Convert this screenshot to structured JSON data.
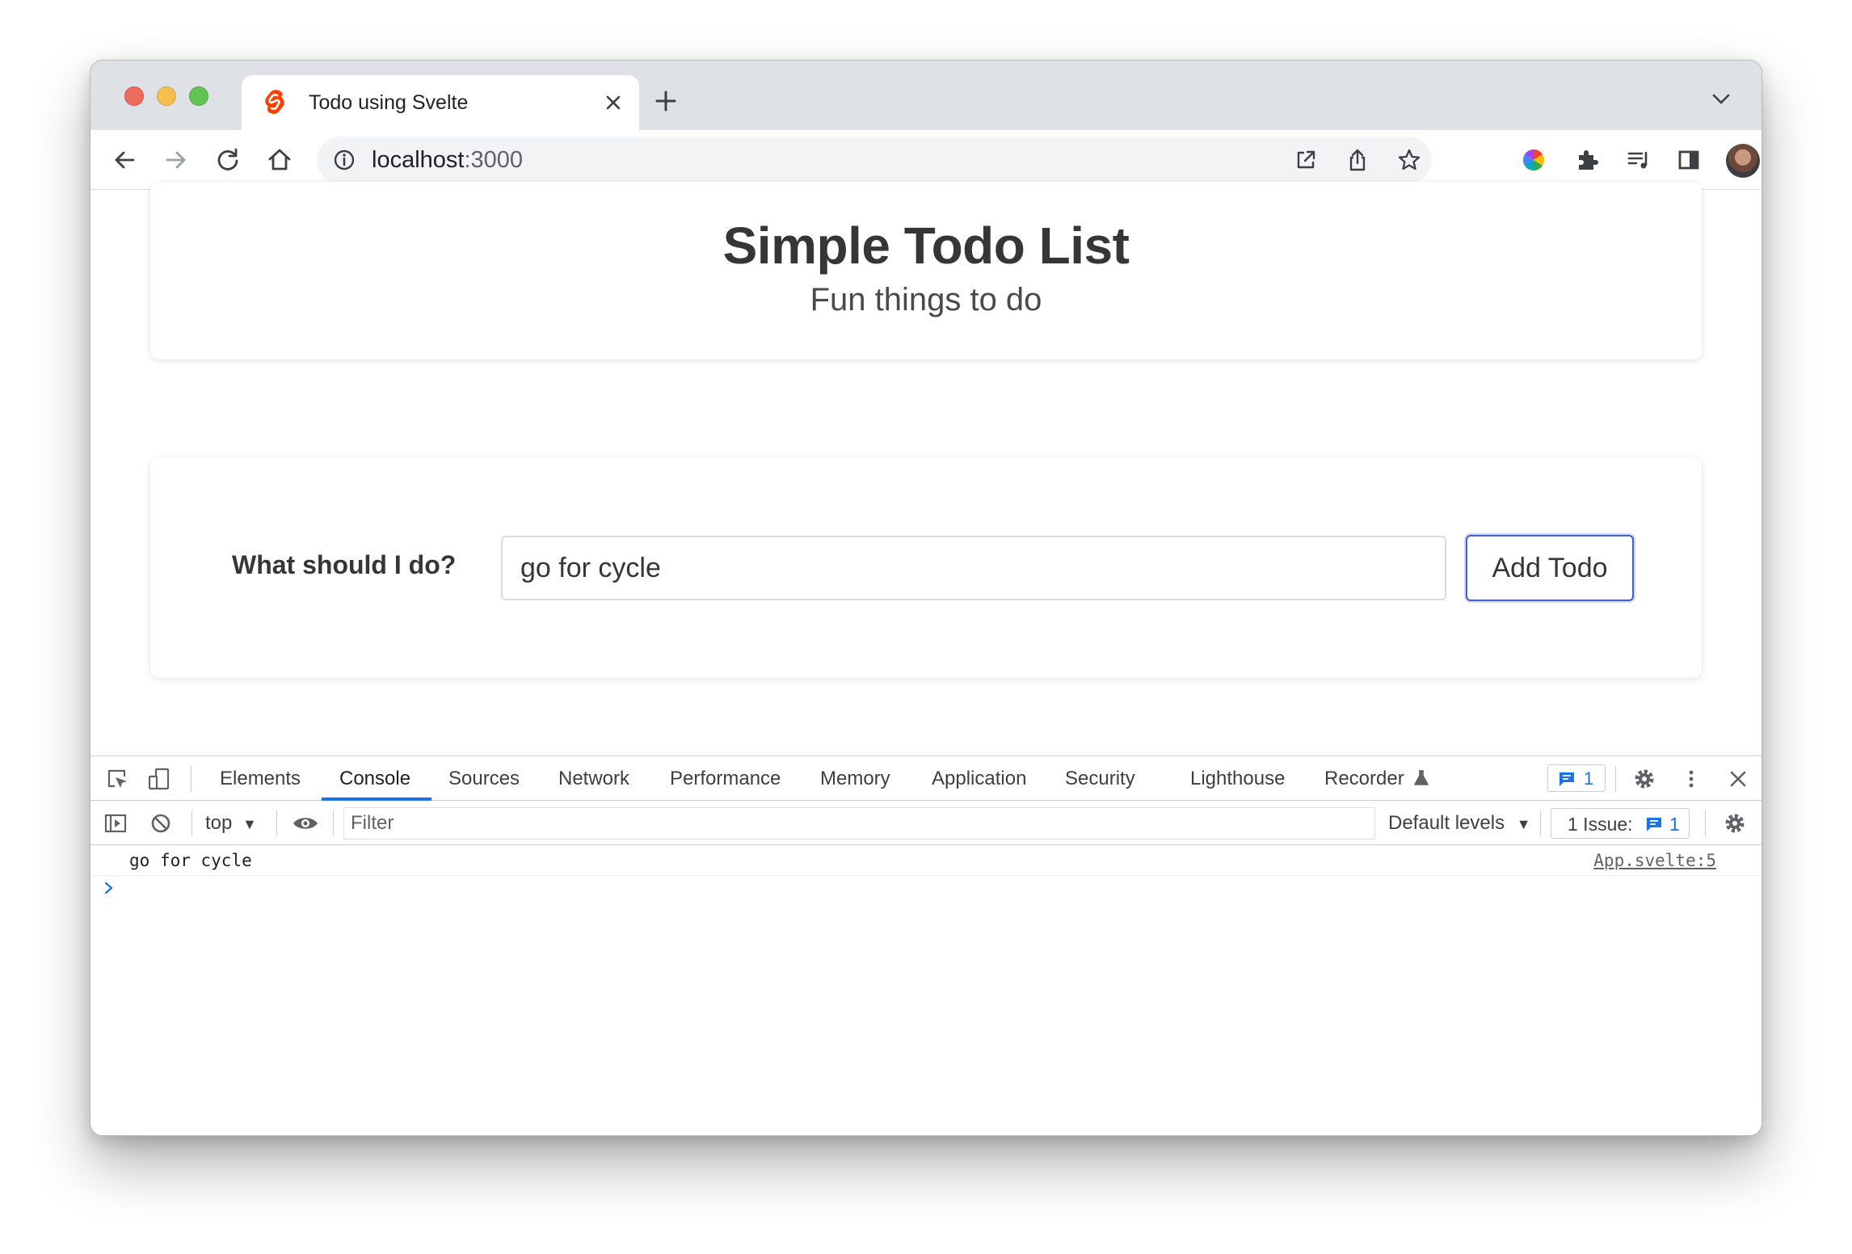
{
  "browser": {
    "tab": {
      "title": "Todo using Svelte",
      "favicon": "svelte-logo-icon"
    },
    "address": {
      "host": "localhost",
      "port": ":3000"
    },
    "colors": {
      "tabstrip": "#dee1e6",
      "omnibox": "#f1f3f4",
      "svelte": "#ff3e00"
    }
  },
  "page": {
    "hero": {
      "title": "Simple Todo List",
      "subtitle": "Fun things to do"
    },
    "form": {
      "label": "What should I do?",
      "input_value": "go for cycle",
      "button_label": "Add Todo",
      "button_border": "#485fc7"
    }
  },
  "devtools": {
    "tabs": [
      {
        "label": "Elements"
      },
      {
        "label": "Console",
        "active": true
      },
      {
        "label": "Sources"
      },
      {
        "label": "Network"
      },
      {
        "label": "Performance"
      },
      {
        "label": "Memory"
      },
      {
        "label": "Application"
      },
      {
        "label": "Security"
      },
      {
        "label": "Lighthouse"
      },
      {
        "label": "Recorder"
      }
    ],
    "message_badge_count": "1",
    "filterbar": {
      "context": "top",
      "filter_placeholder": "Filter",
      "levels": "Default levels",
      "issues_label": "1 Issue:",
      "issues_count": "1"
    },
    "console": {
      "messages": [
        {
          "text": "go for cycle",
          "source": "App.svelte:5"
        }
      ],
      "accent": "#1a73e8"
    }
  }
}
